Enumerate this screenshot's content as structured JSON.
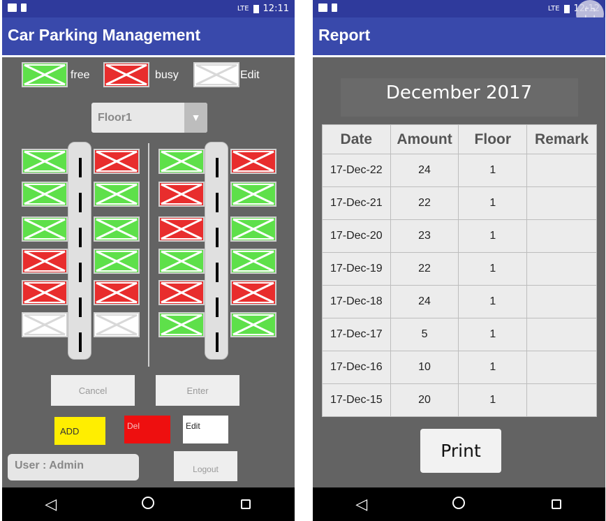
{
  "left_phone": {
    "status": {
      "time": "12:11",
      "signal": "LTE"
    },
    "app_title": "Car Parking Management",
    "legend": {
      "free": "free",
      "busy": "busy",
      "edit": "Edit"
    },
    "floor_select": {
      "value": "Floor1",
      "arrow": "▼"
    },
    "colors": {
      "free": "#5ee04a",
      "busy": "#e82d2d",
      "edit": "#ffffff"
    },
    "slots": {
      "col1": [
        "free",
        "free",
        "free",
        "busy",
        "busy",
        "edit"
      ],
      "col2": [
        "busy",
        "free",
        "free",
        "free",
        "busy",
        "edit"
      ],
      "col3": [
        "free",
        "busy",
        "busy",
        "free",
        "busy",
        "free"
      ],
      "col4": [
        "busy",
        "free",
        "free",
        "free",
        "busy",
        "free"
      ]
    },
    "buttons": {
      "cancel": "Cancel",
      "enter": "Enter",
      "add": "ADD",
      "del": "Del",
      "edit": "Edit",
      "logout": "Logout"
    },
    "user_label": "User : Admin"
  },
  "right_phone": {
    "status": {
      "time": "12:12",
      "signal": "LTE"
    },
    "app_title": "Report",
    "month": "December 2017",
    "table": {
      "headers": [
        "Date",
        "Amount",
        "Floor",
        "Remark"
      ],
      "rows": [
        [
          "17-Dec-22",
          "24",
          "1",
          ""
        ],
        [
          "17-Dec-21",
          "22",
          "1",
          ""
        ],
        [
          "17-Dec-20",
          "23",
          "1",
          ""
        ],
        [
          "17-Dec-19",
          "22",
          "1",
          ""
        ],
        [
          "17-Dec-18",
          "24",
          "1",
          ""
        ],
        [
          "17-Dec-17",
          "5",
          "1",
          ""
        ],
        [
          "17-Dec-16",
          "10",
          "1",
          ""
        ],
        [
          "17-Dec-15",
          "20",
          "1",
          ""
        ]
      ]
    },
    "print_label": "Print"
  },
  "nav": {
    "back": "◁",
    "home": "home-circle-icon",
    "recents": "square-icon"
  }
}
